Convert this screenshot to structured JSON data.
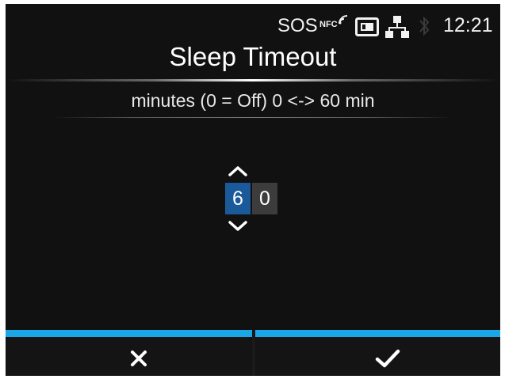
{
  "status_bar": {
    "sos": "SOS",
    "nfc": "NFC",
    "time": "12:21",
    "icons": [
      "nfc-signal-icon",
      "sd-card-icon",
      "network-icon",
      "bluetooth-icon"
    ]
  },
  "header": {
    "title": "Sleep Timeout",
    "subtitle": "minutes (0 = Off) 0 <-> 60 min"
  },
  "spinner": {
    "digits": [
      "6",
      "0"
    ],
    "selected_digit_index": 0,
    "up_icon": "chevron-up-icon",
    "down_icon": "chevron-down-icon"
  },
  "footer": {
    "cancel_icon": "close-icon",
    "confirm_icon": "checkmark-icon"
  },
  "colors": {
    "background": "#111111",
    "accent": "#1ba7e5",
    "selected_digit": "#1a5a9a",
    "unselected_digit": "#3c3c3c"
  }
}
